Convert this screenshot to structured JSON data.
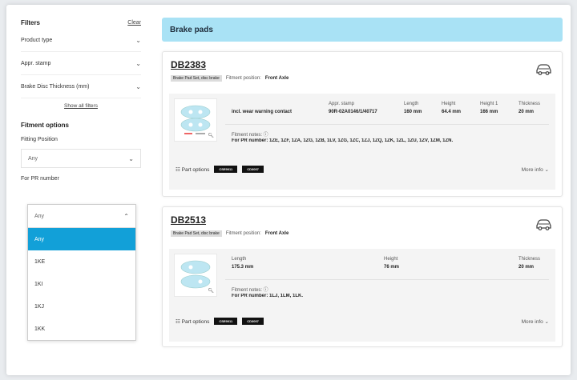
{
  "sidebar": {
    "filters_title": "Filters",
    "clear_label": "Clear",
    "filter_rows": [
      "Product type",
      "Appr. stamp",
      "Brake Disc Thickness (mm)"
    ],
    "show_all": "Show all filters",
    "fitment_title": "Fitment options",
    "fitting_position_label": "Fitting Position",
    "fitting_position_value": "Any",
    "pr_label": "For PR number",
    "pr_value": "Any",
    "pr_options": [
      "Any",
      "1KE",
      "1KI",
      "1KJ",
      "1KK"
    ]
  },
  "main": {
    "title": "Brake pads",
    "products": [
      {
        "code": "DB2383",
        "tag": "Brake Pad Set, disc brake",
        "fitment_label": "Fitment position:",
        "fitment_value": "Front Axle",
        "spec_headers": [
          "Appr. stamp",
          "Length",
          "Height",
          "Height 1",
          "Thickness"
        ],
        "feature": "incl. wear warning contact",
        "spec_values": [
          "90R-02A0146/1/40717",
          "160 mm",
          "64.4 mm",
          "166 mm",
          "20 mm"
        ],
        "notes_label": "Fitment notes: ⓘ",
        "notes_text": "For PR number: 1ZE, 1ZF, 1ZA, 1ZG, 1ZB, 1LV, 1ZG, 1ZC, 1ZJ, 1ZQ, 1ZK, 1ZL, 1ZU, 1ZV, 1ZM, 1ZN.",
        "part_options": "Part options",
        "buttons": [
          "CSE9011",
          "CD3007"
        ],
        "more_info": "More info ⌄"
      },
      {
        "code": "DB2513",
        "tag": "Brake Pad Set, disc brake",
        "fitment_label": "Fitment position:",
        "fitment_value": "Front Axle",
        "spec_headers": [
          "Length",
          "Height",
          "Thickness"
        ],
        "spec_values": [
          "175.3 mm",
          "76 mm",
          "20 mm"
        ],
        "notes_label": "Fitment notes: ⓘ",
        "notes_text": "For PR number: 1LJ, 1LM, 1LK.",
        "part_options": "Part options",
        "buttons": [
          "CSE9011",
          "CD3007"
        ],
        "more_info": "More info ⌄"
      }
    ]
  },
  "colors": {
    "hero": "#a9e2f5",
    "selected": "#12a0d8",
    "button": "#111111"
  }
}
